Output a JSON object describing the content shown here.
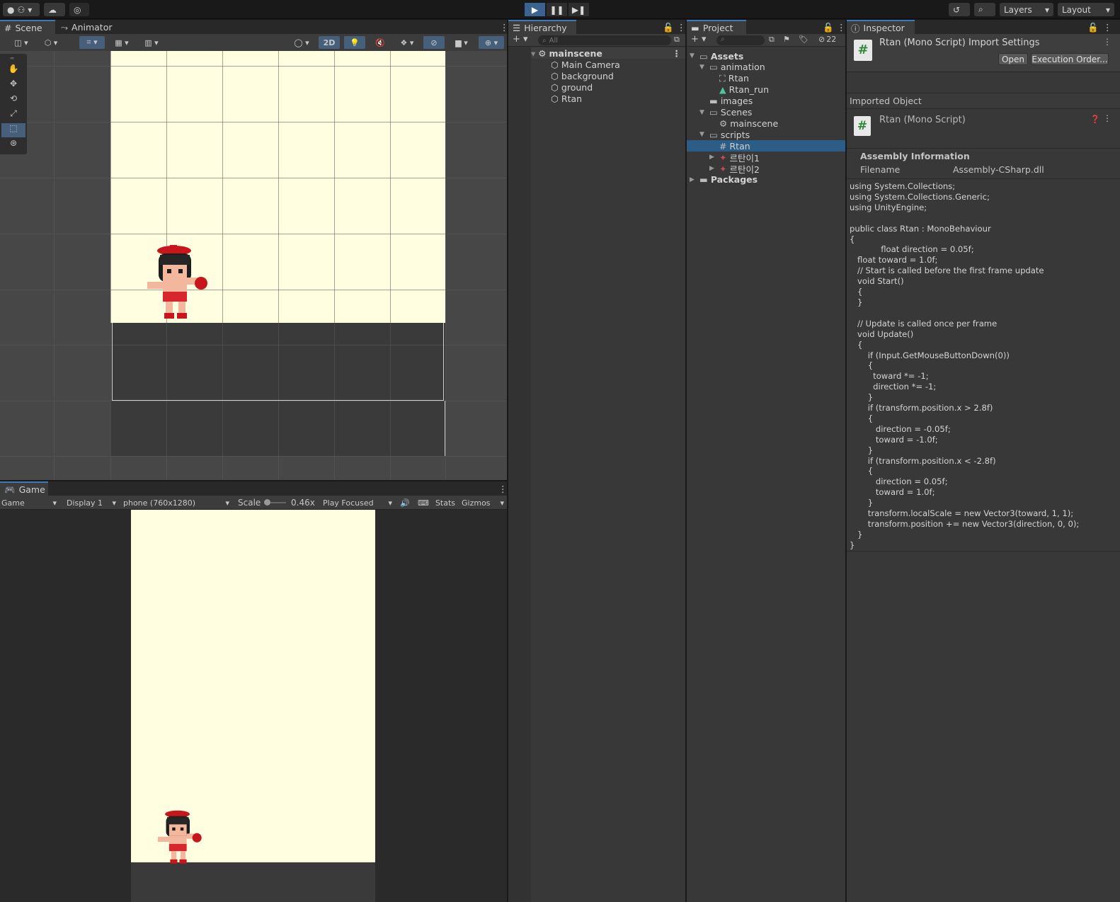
{
  "topbar": {
    "account_label": "",
    "layers_label": "Layers",
    "layout_label": "Layout",
    "play_icon": "play-icon",
    "pause_icon": "pause-icon",
    "step_icon": "step-icon"
  },
  "scene": {
    "tabs": [
      {
        "label": "Scene"
      },
      {
        "label": "Animator"
      }
    ],
    "mode_2d": "2D",
    "colors": {
      "background": "#fffee0",
      "ground": "#3a3a3a",
      "grid": "#4f4f4f",
      "viewport": "#474747"
    }
  },
  "game": {
    "tab_label": "Game",
    "mode_select": "Game",
    "display_select": "Display 1",
    "resolution_select": "phone (760x1280)",
    "scale_label": "Scale",
    "scale_value": "0.46x",
    "play_focused": "Play Focused",
    "stats_label": "Stats",
    "gizmos_label": "Gizmos"
  },
  "hierarchy": {
    "tab_label": "Hierarchy",
    "search_placeholder": "All",
    "scene_name": "mainscene",
    "items": [
      {
        "label": "Main Camera"
      },
      {
        "label": "background"
      },
      {
        "label": "ground"
      },
      {
        "label": "Rtan"
      }
    ]
  },
  "project": {
    "tab_label": "Project",
    "hidden_count": "22",
    "tree": [
      {
        "label": "Assets",
        "indent": 0,
        "icon": "folder-open-icon"
      },
      {
        "label": "animation",
        "indent": 1,
        "icon": "folder-open-icon"
      },
      {
        "label": "Rtan",
        "indent": 2,
        "icon": "animator-controller-icon"
      },
      {
        "label": "Rtan_run",
        "indent": 2,
        "icon": "animation-clip-icon"
      },
      {
        "label": "images",
        "indent": 1,
        "icon": "folder-icon"
      },
      {
        "label": "Scenes",
        "indent": 1,
        "icon": "folder-open-icon"
      },
      {
        "label": "mainscene",
        "indent": 2,
        "icon": "unity-scene-icon"
      },
      {
        "label": "scripts",
        "indent": 1,
        "icon": "folder-open-icon"
      },
      {
        "label": "Rtan",
        "indent": 2,
        "icon": "csharp-script-icon",
        "selected": true
      },
      {
        "label": "르탄이1",
        "indent": 2,
        "icon": "sprite-icon"
      },
      {
        "label": "르탄이2",
        "indent": 2,
        "icon": "sprite-icon"
      },
      {
        "label": "Packages",
        "indent": 0,
        "icon": "folder-icon"
      }
    ]
  },
  "inspector": {
    "tab_label": "Inspector",
    "header_title": "Rtan (Mono Script) Import Settings",
    "open_button": "Open",
    "execution_order_button": "Execution Order...",
    "imported_object_label": "Imported Object",
    "object_title": "Rtan (Mono Script)",
    "assembly_heading": "Assembly Information",
    "filename_label": "Filename",
    "filename_value": "Assembly-CSharp.dll",
    "code": "using System.Collections;\nusing System.Collections.Generic;\nusing UnityEngine;\n\npublic class Rtan : MonoBehaviour\n{\n            float direction = 0.05f;\n   float toward = 1.0f;\n   // Start is called before the first frame update\n   void Start()\n   {\n   }\n\n   // Update is called once per frame\n   void Update()\n   {\n       if (Input.GetMouseButtonDown(0))\n       {\n         toward *= -1;\n         direction *= -1;\n       }\n       if (transform.position.x > 2.8f)\n       {\n          direction = -0.05f;\n          toward = -1.0f;\n       }\n       if (transform.position.x < -2.8f)\n       {\n          direction = 0.05f;\n          toward = 1.0f;\n       }\n       transform.localScale = new Vector3(toward, 1, 1);\n       transform.position += new Vector3(direction, 0, 0);\n   }\n}"
  }
}
